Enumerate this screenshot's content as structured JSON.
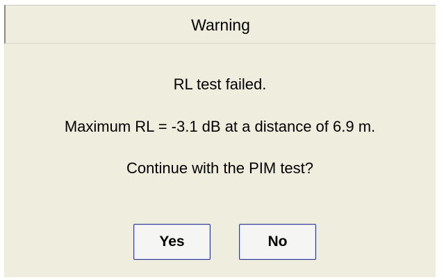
{
  "dialog": {
    "title": "Warning",
    "message_lines": [
      "RL test failed.",
      "Maximum RL = -3.1 dB at a distance of 6.9 m.",
      "Continue with the PIM test?"
    ],
    "buttons": {
      "yes_label": "Yes",
      "no_label": "No"
    }
  },
  "colors": {
    "dialog_background": "#efedde",
    "button_border": "#2e3a8c"
  }
}
